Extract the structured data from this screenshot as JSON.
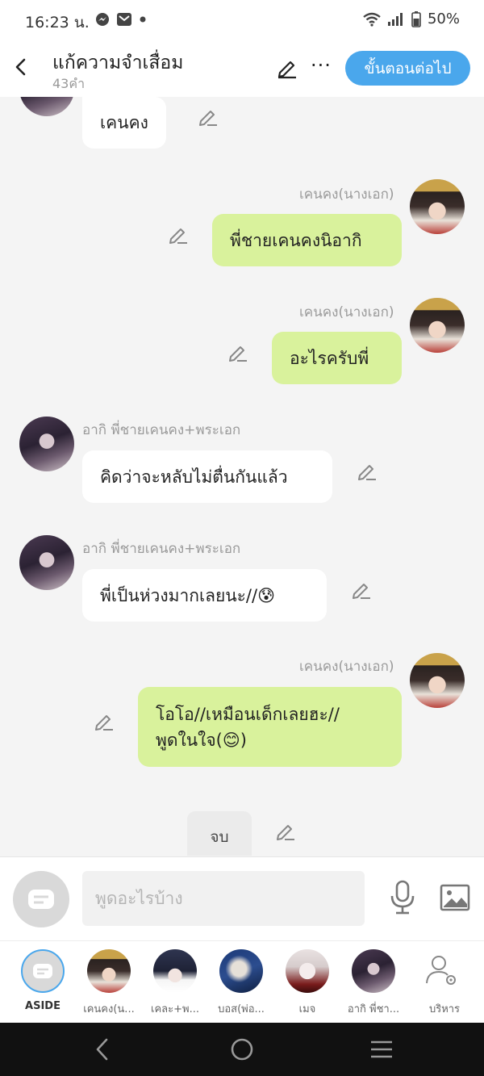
{
  "status_bar": {
    "time": "16:23 น.",
    "battery": "50%",
    "icons": [
      "messenger-icon",
      "mail-icon",
      "dot-icon",
      "wifi-icon",
      "signal-icon",
      "battery-icon"
    ]
  },
  "header": {
    "title": "แก้ความจำเสื่อม",
    "subtitle": "43คำ",
    "next_button": "ขั้นตอนต่อไป",
    "more": "···"
  },
  "colors": {
    "accent": "#4aa7ec",
    "bubble_green": "#d9f29c",
    "bubble_white": "#ffffff",
    "background": "#f4f4f4"
  },
  "messages": [
    {
      "side": "left",
      "text": "เคนคง"
    },
    {
      "side": "right",
      "name": "เคนคง(นางเอก)",
      "text": "พี่ชายเคนคงนิอากิ"
    },
    {
      "side": "right",
      "name": "เคนคง(นางเอก)",
      "text": "อะไรครับพี่"
    },
    {
      "side": "left",
      "name": "อากิ พี่ชายเคนคง+พระเอก",
      "text": "คิดว่าจะหลับไม่ตื่นกันแล้ว"
    },
    {
      "side": "left",
      "name": "อากิ พี่ชายเคนคง+พระเอก",
      "text": "พี่เป็นห่วงมากเลยนะ//😰"
    },
    {
      "side": "right",
      "name": "เคนคง(นางเอก)",
      "lines": [
        "โอโอ//เหมือนเด็กเลยฮะ//",
        "พูดในใจ(😊)"
      ]
    }
  ],
  "end_marker": "จบ",
  "input": {
    "placeholder": "พูดอะไรบ้าง"
  },
  "characters": [
    {
      "label": "ASIDE",
      "icon": "aside-icon"
    },
    {
      "label": "เคนคง(น..."
    },
    {
      "label": "เคละ+พ..."
    },
    {
      "label": "บอส(พ่อ..."
    },
    {
      "label": "เมจ"
    },
    {
      "label": "อากิ พี่ชา..."
    },
    {
      "label": "บริหาร",
      "icon": "manage-user-icon"
    }
  ]
}
